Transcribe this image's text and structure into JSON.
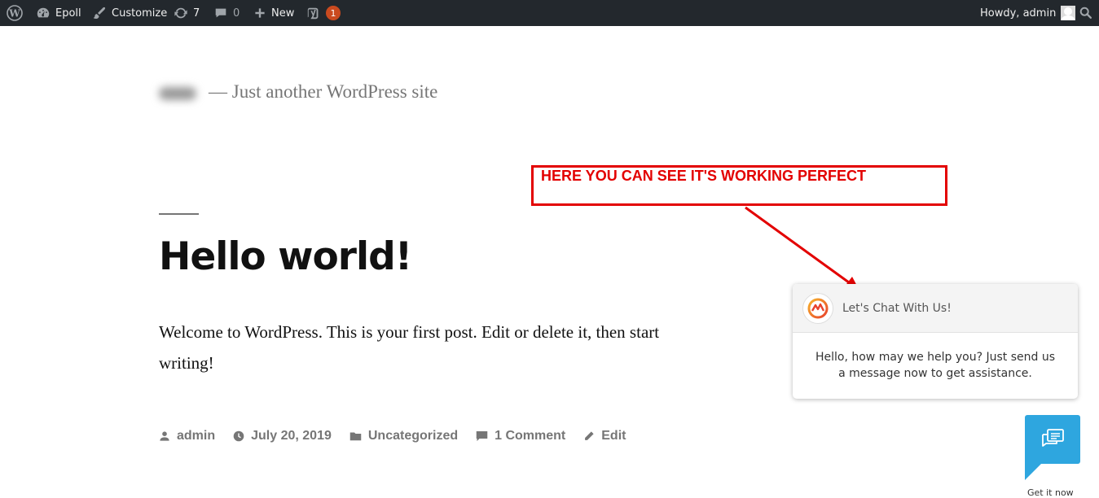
{
  "admin_bar": {
    "site_name": "Epoll",
    "customize": "Customize",
    "updates_count": "7",
    "comments_count": "0",
    "new_label": "New",
    "seo_badge": "1",
    "howdy": "Howdy, admin"
  },
  "site": {
    "description": "— Just another WordPress site"
  },
  "post": {
    "title": "Hello world!",
    "body": "Welcome to WordPress. This is your first post. Edit or delete it, then start writing!",
    "meta": {
      "author": "admin",
      "date": "July 20, 2019",
      "category": "Uncategorized",
      "comments": "1 Comment",
      "edit": "Edit"
    }
  },
  "annotation": {
    "text": "HERE YOU CAN SEE IT'S WORKING PERFECT",
    "color": "#e30000"
  },
  "chat": {
    "title": "Let's Chat With Us!",
    "message": "Hello, how may we help you? Just send us a message now to get assistance.",
    "cta": "Get it now",
    "accent": "#2ea6df"
  },
  "colors": {
    "admin_bar_bg": "#23282d",
    "badge": "#ca4a1f"
  }
}
